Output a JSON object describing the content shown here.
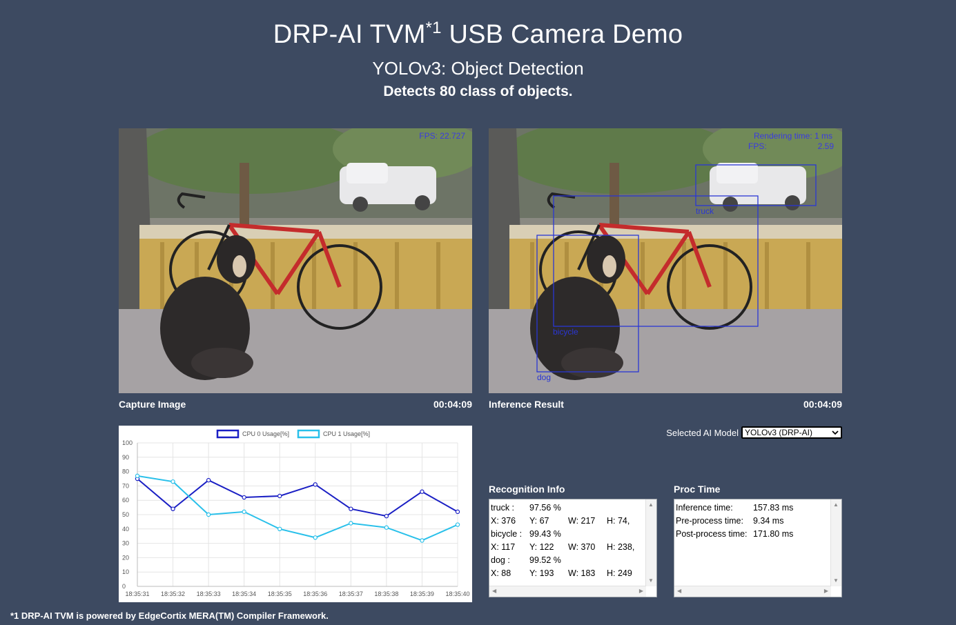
{
  "header": {
    "title_main": "DRP-AI TVM",
    "title_sup": "*1",
    "title_rest": "USB Camera Demo",
    "subtitle": "YOLOv3: Object Detection",
    "description": "Detects 80 class of objects."
  },
  "capture": {
    "label": "Capture Image",
    "time": "00:04:09",
    "fps_text": "FPS: 22.727"
  },
  "inference": {
    "label": "Inference Result",
    "time": "00:04:09",
    "rendering_text": "Rendering time: 1 ms",
    "fps_label": "FPS:",
    "fps_value": "2.59",
    "boxes": [
      {
        "label": "truck"
      },
      {
        "label": "bicycle"
      },
      {
        "label": "dog"
      }
    ]
  },
  "model": {
    "label": "Selected AI Model",
    "selected": "YOLOv3 (DRP-AI)"
  },
  "recognition": {
    "title": "Recognition Info",
    "rows": [
      [
        "truck :",
        "97.56 %",
        "",
        ""
      ],
      [
        "X: 376",
        "Y: 67",
        "W: 217",
        "H: 74,"
      ],
      [
        "bicycle :",
        "99.43 %",
        "",
        ""
      ],
      [
        "X: 117",
        "Y: 122",
        "W: 370",
        "H: 238,"
      ],
      [
        "dog :",
        "99.52 %",
        "",
        ""
      ],
      [
        "X: 88",
        "Y: 193",
        "W: 183",
        "H: 249"
      ]
    ]
  },
  "proc": {
    "title": "Proc Time",
    "rows": [
      [
        "Inference time:",
        "157.83 ms"
      ],
      [
        "Pre-process time:",
        "9.34 ms"
      ],
      [
        "Post-process time:",
        "171.80 ms"
      ]
    ]
  },
  "colors": {
    "background": "#3d4a61",
    "cpu0": "#1a1fc4",
    "cpu1": "#29c0ea",
    "box": "#2a36d4"
  },
  "chart_data": {
    "type": "line",
    "title": "",
    "xlabel": "",
    "ylabel": "",
    "ylim": [
      0,
      100
    ],
    "yticks": [
      0,
      10,
      20,
      30,
      40,
      50,
      60,
      70,
      80,
      90,
      100
    ],
    "x": [
      "18:35:31",
      "18:35:32",
      "18:35:33",
      "18:35:34",
      "18:35:35",
      "18:35:36",
      "18:35:37",
      "18:35:38",
      "18:35:39",
      "18:35:40"
    ],
    "series": [
      {
        "name": "CPU 0 Usage[%]",
        "color": "#1a1fc4",
        "values": [
          75,
          54,
          74,
          62,
          63,
          71,
          54,
          49,
          66,
          52
        ]
      },
      {
        "name": "CPU 1 Usage[%]",
        "color": "#29c0ea",
        "values": [
          77,
          73,
          50,
          52,
          40,
          34,
          44,
          41,
          32,
          43
        ]
      }
    ],
    "grid": true,
    "legend_position": "top"
  },
  "footer": {
    "text": "*1 DRP-AI TVM is powered by EdgeCortix MERA(TM) Compiler Framework."
  }
}
